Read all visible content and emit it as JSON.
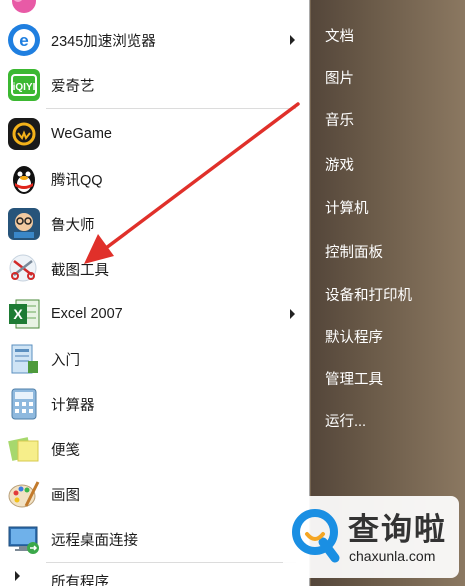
{
  "left_menu": {
    "items": [
      {
        "label": "2345加速浏览器",
        "icon": "browser-2345-icon",
        "has_arrow": true
      },
      {
        "label": "爱奇艺",
        "icon": "iqiyi-icon",
        "has_arrow": false
      },
      {
        "label": "WeGame",
        "icon": "wegame-icon",
        "has_arrow": false
      },
      {
        "label": "腾讯QQ",
        "icon": "qq-penguin-icon",
        "has_arrow": false
      },
      {
        "label": "鲁大师",
        "icon": "ludashi-icon",
        "has_arrow": false
      },
      {
        "label": "截图工具",
        "icon": "snipping-tool-icon",
        "has_arrow": false
      },
      {
        "label": "Excel 2007",
        "icon": "excel-icon",
        "has_arrow": true
      },
      {
        "label": "入门",
        "icon": "getting-started-icon",
        "has_arrow": false
      },
      {
        "label": "计算器",
        "icon": "calculator-icon",
        "has_arrow": false
      },
      {
        "label": "便笺",
        "icon": "sticky-notes-icon",
        "has_arrow": false
      },
      {
        "label": "画图",
        "icon": "paint-icon",
        "has_arrow": false
      },
      {
        "label": "远程桌面连接",
        "icon": "remote-desktop-icon",
        "has_arrow": false
      }
    ],
    "all_programs": "所有程序"
  },
  "right_menu": {
    "items": [
      "文档",
      "图片",
      "音乐",
      "游戏",
      "计算机",
      "控制面板",
      "设备和打印机",
      "默认程序",
      "管理工具",
      "运行..."
    ]
  },
  "watermark": {
    "brand": "查询啦",
    "url": "chaxunla.com"
  },
  "colors": {
    "annotation_arrow": "#e0302a",
    "watermark_blue": "#1a8fe3",
    "watermark_orange": "#f5a623"
  }
}
